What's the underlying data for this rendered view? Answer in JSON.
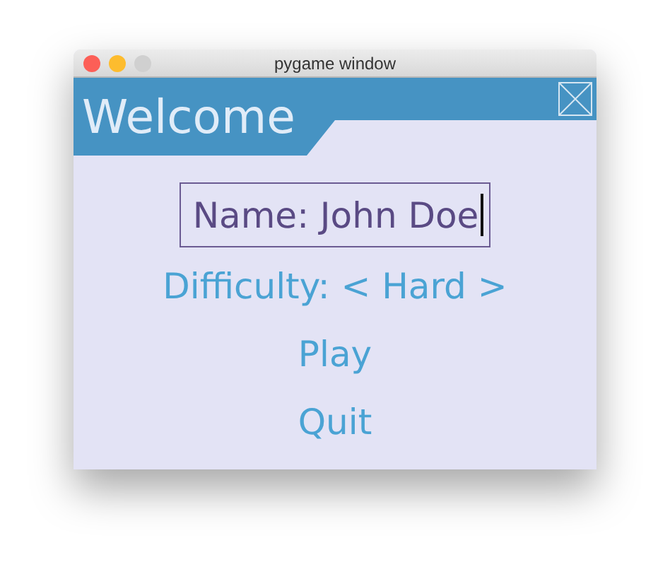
{
  "window": {
    "title": "pygame window"
  },
  "menu": {
    "title": "Welcome",
    "items": [
      {
        "kind": "text_input",
        "text": "Name: John Doe",
        "selected": true
      },
      {
        "kind": "selector",
        "text": "Difficulty: < Hard >",
        "selected": false
      },
      {
        "kind": "button",
        "text": "Play",
        "selected": false
      },
      {
        "kind": "button",
        "text": "Quit",
        "selected": false
      }
    ]
  }
}
